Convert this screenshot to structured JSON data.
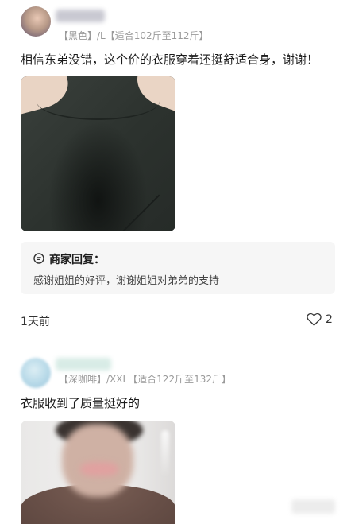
{
  "reviews": [
    {
      "spec": "【黑色】/L【适合102斤至112斤】",
      "text": "相信东弟没错，这个价的衣服穿着还挺舒适合身，谢谢！",
      "reply": {
        "title": "商家回复：",
        "text": "感谢姐姐的好评，谢谢姐姐对弟弟的支持"
      },
      "time": "1天前",
      "likes": "2"
    },
    {
      "spec": "【深咖啡】/XXL【适合122斤至132斤】",
      "text": "衣服收到了质量挺好的"
    }
  ],
  "icons": {
    "reply": "chat-bubble-icon",
    "like": "heart-outline-icon"
  }
}
